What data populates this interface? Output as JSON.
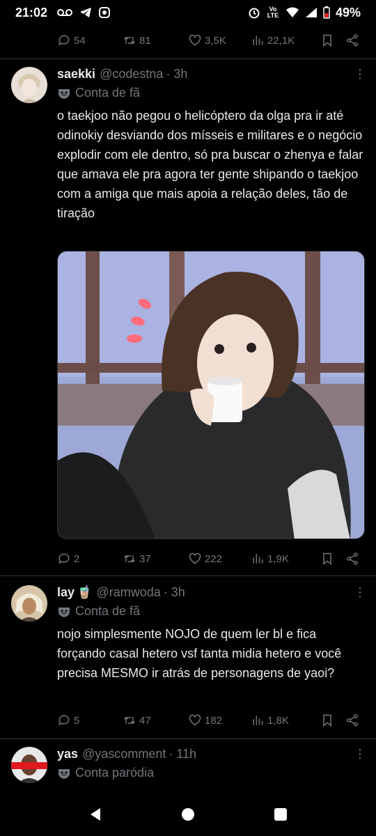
{
  "status": {
    "time": "21:02",
    "battery": "49%",
    "network": "Vo LTE"
  },
  "top_actions": {
    "reply": "54",
    "retweet": "81",
    "like": "3,5K",
    "views": "22,1K"
  },
  "tweets": [
    {
      "name": "saekki",
      "handle": "@codestna",
      "time": "· 3h",
      "badge": "Conta de fã",
      "text": "o taekjoo não pegou o helicóptero da olga pra ir até odinokiy desviando dos mísseis e militares e o negócio explodir com ele dentro, só pra buscar o zhenya e falar que amava ele pra agora ter gente shipando o taekjoo com a amiga que mais apoia a relação deles, tão de tiração",
      "actions": {
        "reply": "2",
        "retweet": "37",
        "like": "222",
        "views": "1,9K"
      }
    },
    {
      "name": "lay",
      "emoji": "🧋",
      "handle": "@ramwoda",
      "time": "· 3h",
      "badge": "Conta de fã",
      "text": "nojo simplesmente NOJO de quem ler bl e fica forçando casal hetero vsf tanta midia hetero e você precisa MESMO ir atrás de personagens de yaoi?",
      "actions": {
        "reply": "5",
        "retweet": "47",
        "like": "182",
        "views": "1,8K"
      }
    },
    {
      "name": "yas",
      "handle": "@yascomment",
      "time": "· 11h",
      "badge": "Conta paródia"
    }
  ],
  "colors": {
    "background": "#000000",
    "text": "#e7e9ea",
    "muted": "#71767b",
    "divider": "#2f3336"
  }
}
